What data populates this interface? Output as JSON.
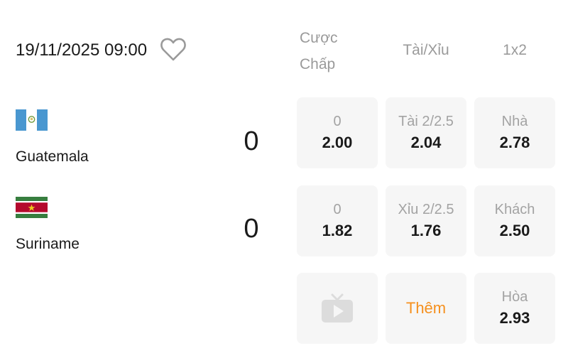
{
  "match": {
    "datetime": "19/11/2025 09:00"
  },
  "headers": {
    "handicap_line1": "Cược",
    "handicap_line2": "Chấp",
    "over_under": "Tài/Xỉu",
    "one_x_two": "1x2"
  },
  "home": {
    "name": "Guatemala",
    "score": "0",
    "handicap_label": "0",
    "handicap_odd": "2.00",
    "ou_label": "Tài 2/2.5",
    "ou_odd": "2.04",
    "x12_label": "Nhà",
    "x12_odd": "2.78"
  },
  "away": {
    "name": "Suriname",
    "score": "0",
    "handicap_label": "0",
    "handicap_odd": "1.82",
    "ou_label": "Xỉu 2/2.5",
    "ou_odd": "1.76",
    "x12_label": "Khách",
    "x12_odd": "2.50"
  },
  "extra": {
    "more_label": "Thêm",
    "draw_label": "Hòa",
    "draw_odd": "2.93"
  },
  "colors": {
    "accent": "#f5901e",
    "cell_bg": "#f6f6f6",
    "muted_text": "#9a9a9a"
  },
  "icons": {
    "favorite": "heart-outline-icon",
    "live": "tv-icon"
  }
}
